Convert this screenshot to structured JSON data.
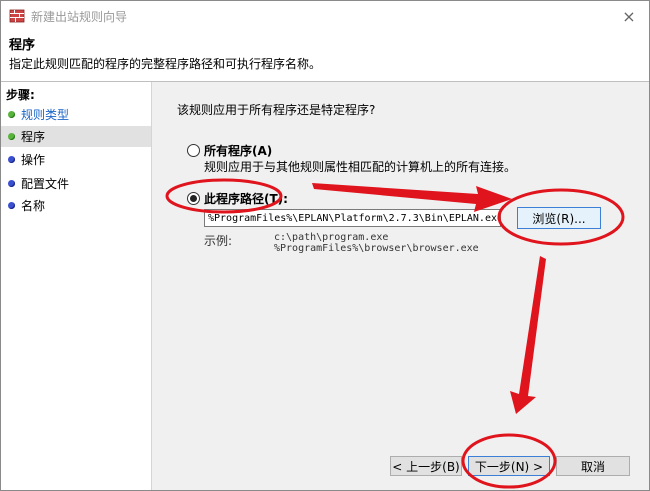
{
  "window": {
    "title": "新建出站规则向导",
    "close_icon": "×"
  },
  "header": {
    "title": "程序",
    "description": "指定此规则匹配的程序的完整程序路径和可执行程序名称。"
  },
  "sidebar": {
    "steps_title": "步骤:",
    "items": [
      {
        "label": "规则类型",
        "status": "completed",
        "color": "green"
      },
      {
        "label": "程序",
        "status": "current",
        "color": "green"
      },
      {
        "label": "操作",
        "status": "pending",
        "color": "blue"
      },
      {
        "label": "配置文件",
        "status": "pending",
        "color": "blue"
      },
      {
        "label": "名称",
        "status": "pending",
        "color": "blue"
      }
    ]
  },
  "main": {
    "question": "该规则应用于所有程序还是特定程序?",
    "options": [
      {
        "label": "所有程序(A)",
        "description": "规则应用于与其他规则属性相匹配的计算机上的所有连接。",
        "checked": false
      },
      {
        "label": "此程序路径(T):",
        "checked": true
      }
    ],
    "path_value": "%ProgramFiles%\\EPLAN\\Platform\\2.7.3\\Bin\\EPLAN.exe",
    "browse_label": "浏览(R)...",
    "example_label": "示例:",
    "example_lines": "c:\\path\\program.exe\n%ProgramFiles%\\browser\\browser.exe"
  },
  "footer": {
    "back_label": "< 上一步(B)",
    "next_label": "下一步(N) >",
    "cancel_label": "取消"
  },
  "annotation_color": "#e0141c"
}
